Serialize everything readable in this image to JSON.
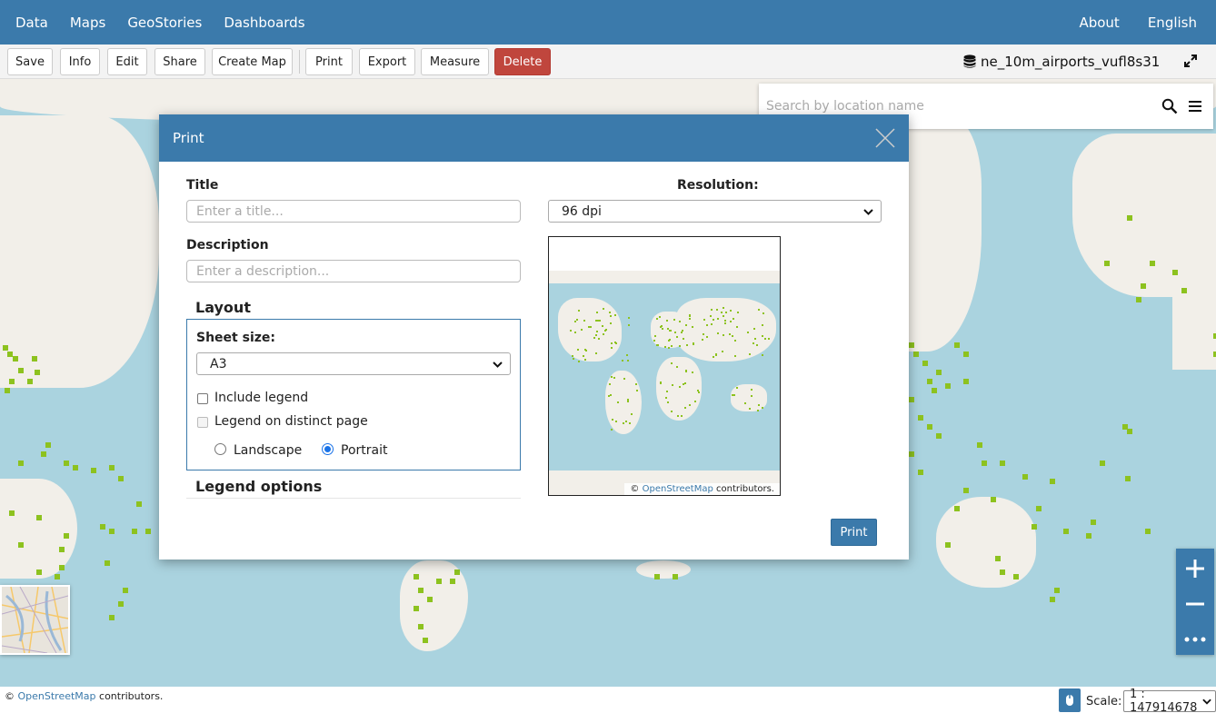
{
  "nav": {
    "left": [
      "Data",
      "Maps",
      "GeoStories",
      "Dashboards"
    ],
    "right": [
      "About",
      "English"
    ]
  },
  "toolbar": {
    "save": "Save",
    "info": "Info",
    "edit": "Edit",
    "share": "Share",
    "create_map": "Create Map",
    "print": "Print",
    "export": "Export",
    "measure": "Measure",
    "delete": "Delete",
    "resource_name": "ne_10m_airports_vufl8s31"
  },
  "search": {
    "placeholder": "Search by location name"
  },
  "print_dialog": {
    "title": "Print",
    "title_label": "Title",
    "title_placeholder": "Enter a title...",
    "description_label": "Description",
    "description_placeholder": "Enter a description...",
    "layout_heading": "Layout",
    "sheet_size_label": "Sheet size:",
    "sheet_size_value": "A3",
    "include_legend": "Include legend",
    "legend_distinct_page": "Legend on distinct page",
    "landscape": "Landscape",
    "portrait": "Portrait",
    "orientation": "Portrait",
    "legend_options_heading": "Legend options",
    "resolution_label": "Resolution:",
    "resolution_value": "96 dpi",
    "preview_attribution_prefix": "©",
    "preview_attribution_link": "OpenStreetMap",
    "preview_attribution_suffix": "contributors.",
    "print_button": "Print"
  },
  "map": {
    "attribution_prefix": "©",
    "attribution_link": "OpenStreetMap",
    "attribution_suffix": "contributors.",
    "scale_label": "Scale:",
    "scale_value": "1 : 147914678",
    "point_color": "#8dc21f"
  },
  "colors": {
    "brand": "#3b7aab",
    "danger": "#c0463d",
    "water": "#aad3df",
    "land": "#f2efe9"
  }
}
